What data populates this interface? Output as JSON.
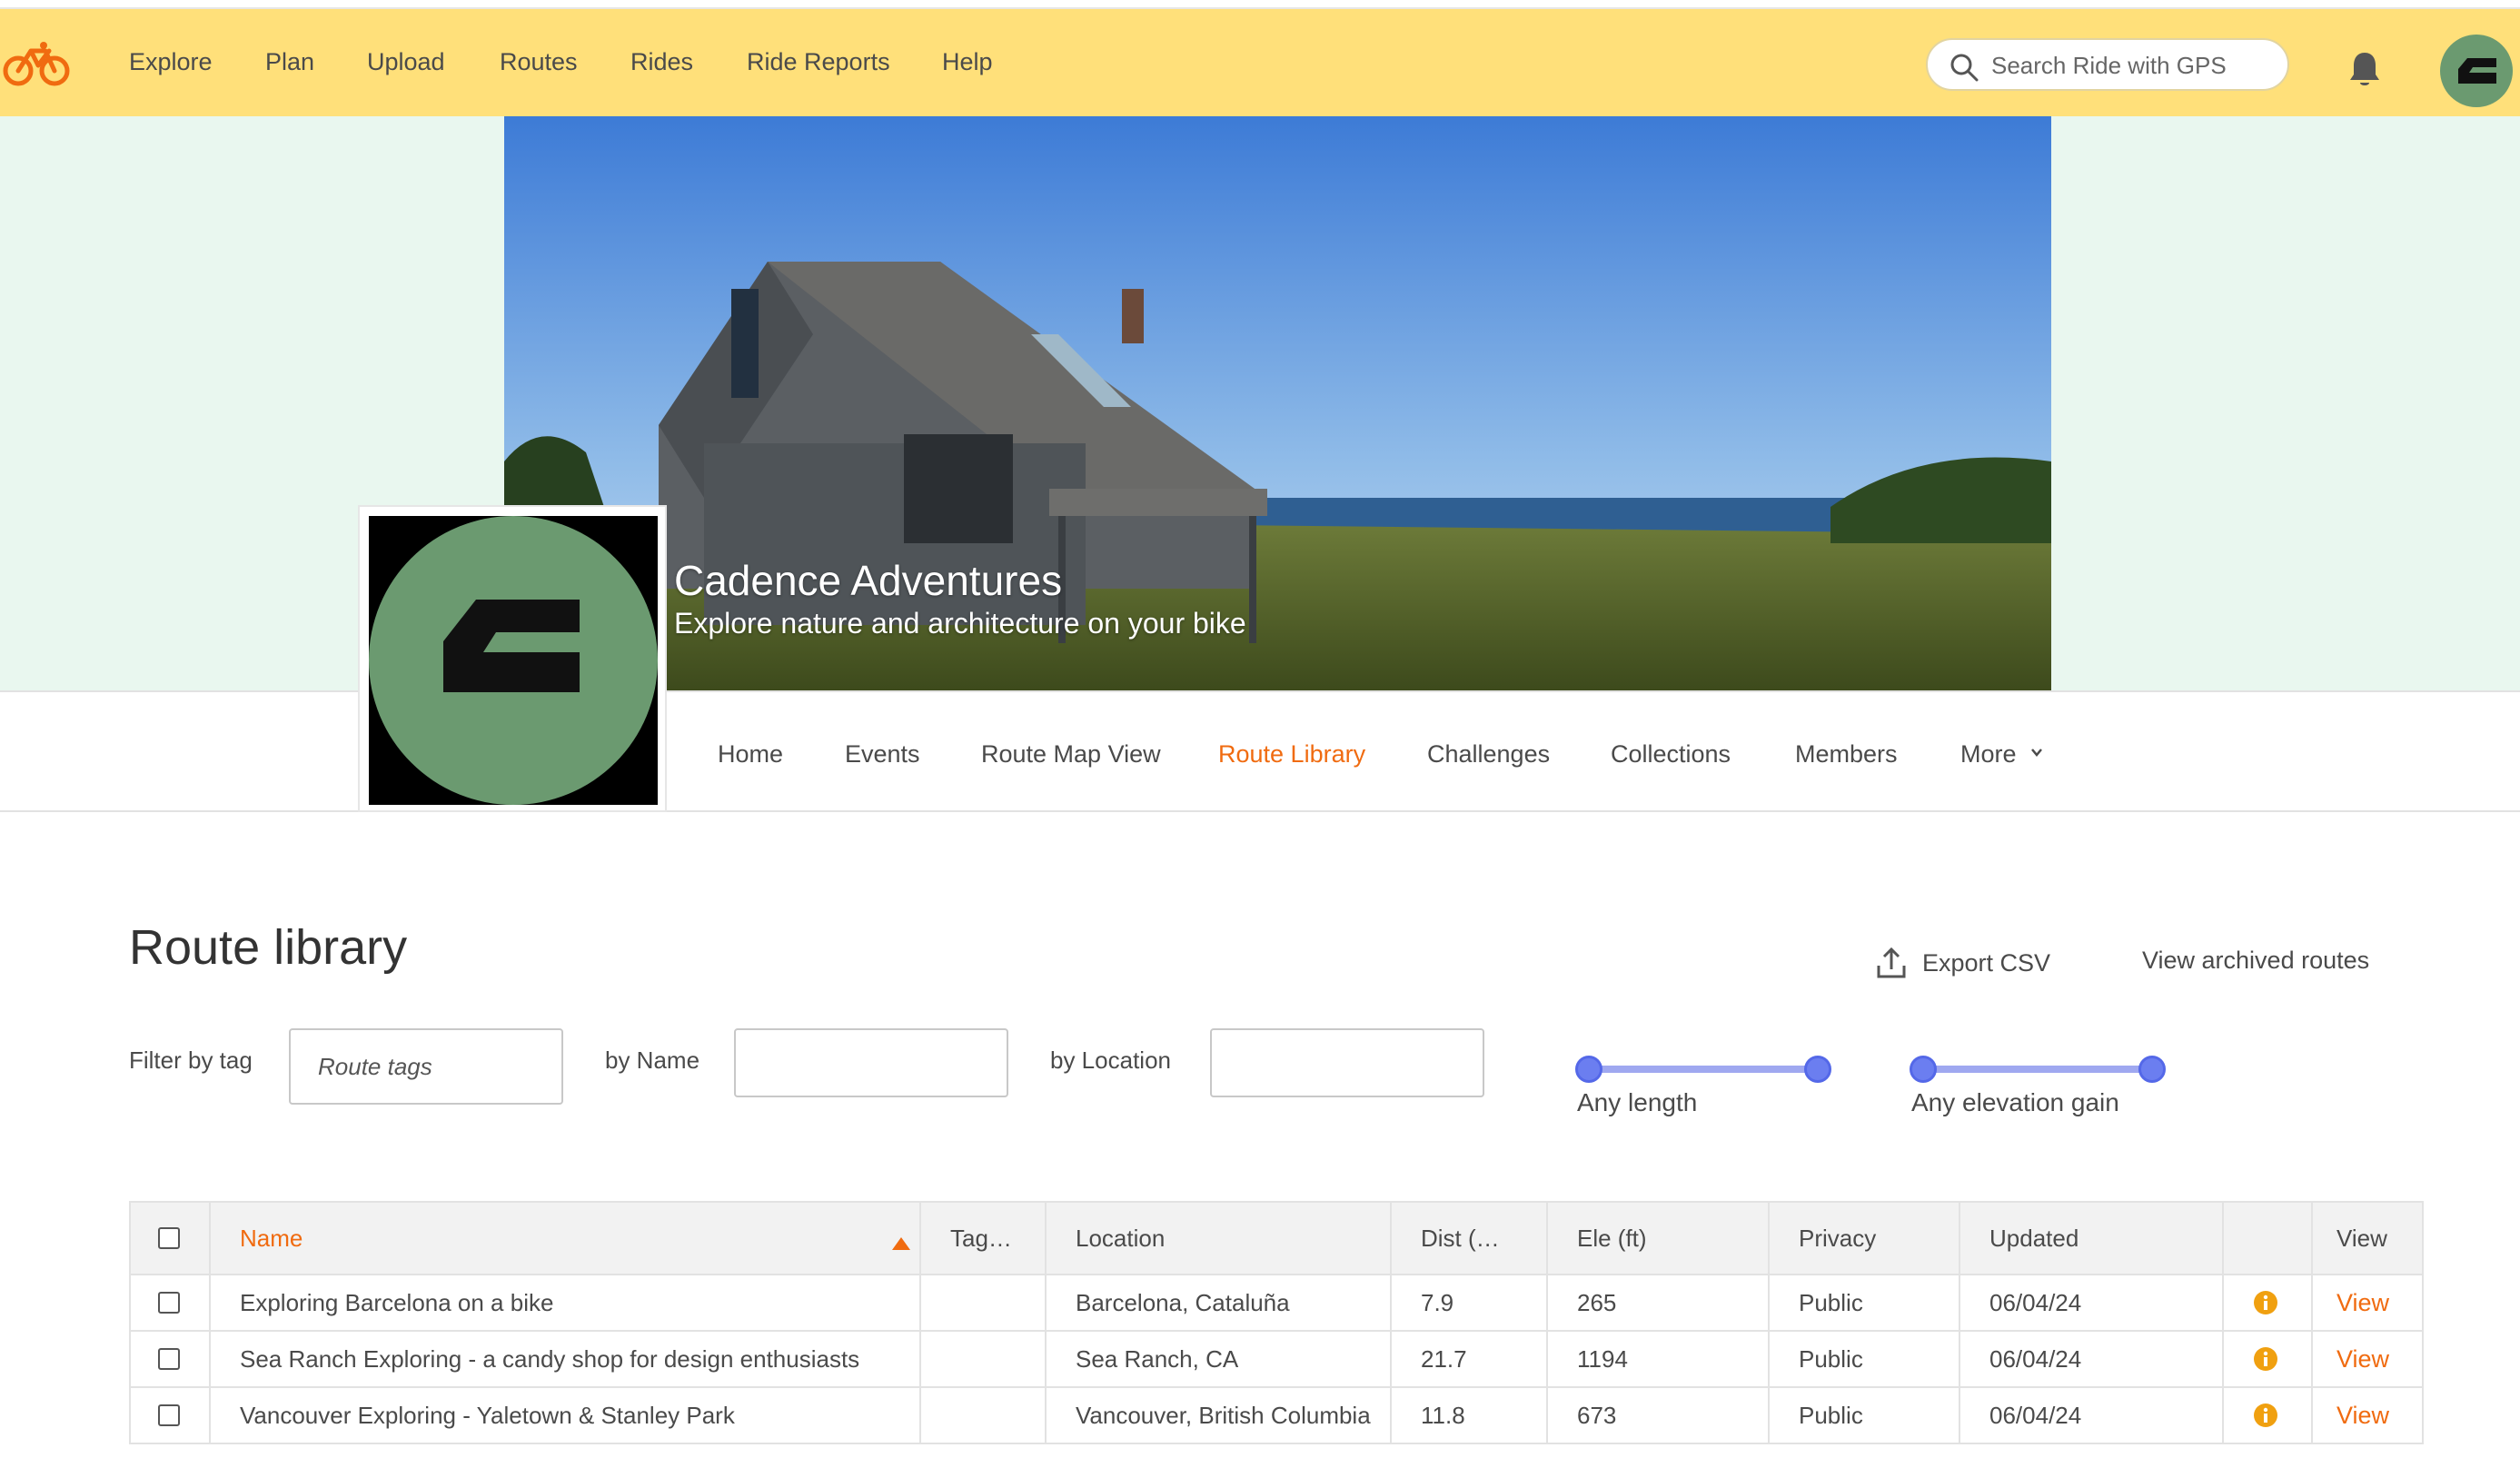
{
  "topnav": {
    "items": [
      "Explore",
      "Plan",
      "Upload",
      "Routes",
      "Rides",
      "Ride Reports",
      "Help"
    ],
    "search_placeholder": "Search Ride with GPS"
  },
  "club": {
    "name": "Cadence Adventures",
    "tagline": "Explore nature and architecture on your bike",
    "tabs": [
      "Home",
      "Events",
      "Route Map View",
      "Route Library",
      "Challenges",
      "Collections",
      "Members",
      "More"
    ],
    "active_tab": "Route Library"
  },
  "library": {
    "title": "Route library",
    "export_label": "Export CSV",
    "archived_label": "View archived routes",
    "filters": {
      "tag_label": "Filter by tag",
      "tag_placeholder": "Route tags",
      "name_label": "by Name",
      "location_label": "by Location",
      "length_label": "Any length",
      "elevation_label": "Any elevation gain"
    },
    "columns": [
      "Name",
      "Tag…",
      "Location",
      "Dist (…",
      "Ele (ft)",
      "Privacy",
      "Updated",
      "View"
    ],
    "rows": [
      {
        "name": "Exploring Barcelona on a bike",
        "tags": "",
        "location": "Barcelona, Cataluña",
        "dist": "7.9",
        "ele": "265",
        "privacy": "Public",
        "updated": "06/04/24",
        "view": "View"
      },
      {
        "name": "Sea Ranch Exploring - a candy shop for design enthusiasts",
        "tags": "",
        "location": "Sea Ranch, CA",
        "dist": "21.7",
        "ele": "1194",
        "privacy": "Public",
        "updated": "06/04/24",
        "view": "View"
      },
      {
        "name": "Vancouver Exploring - Yaletown & Stanley Park",
        "tags": "",
        "location": "Vancouver, British Columbia",
        "dist": "11.8",
        "ele": "673",
        "privacy": "Public",
        "updated": "06/04/24",
        "view": "View"
      }
    ]
  },
  "colors": {
    "topbar": "#ffe07a",
    "accent": "#f06b10",
    "slider": "#6b7ef0",
    "avatar_green": "#6b9a70"
  },
  "icons": [
    "bike-logo-icon",
    "search-icon",
    "bell-icon",
    "chevron-down-icon",
    "export-icon",
    "info-icon",
    "sort-asc-icon"
  ]
}
